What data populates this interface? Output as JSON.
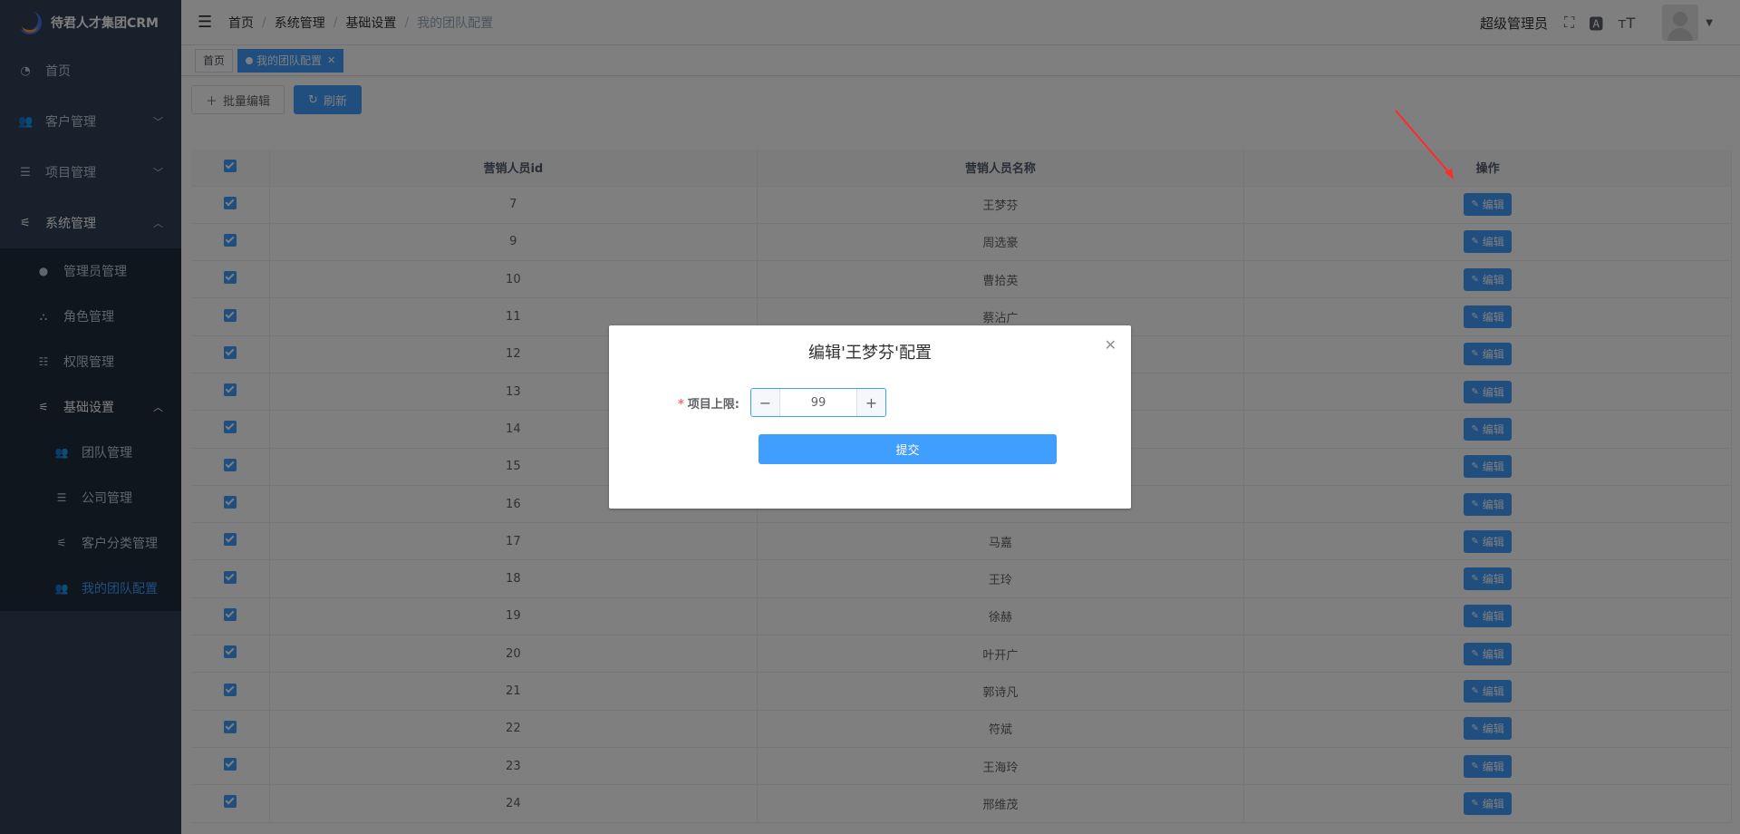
{
  "app": {
    "logo_text": "待君人才集团CRM"
  },
  "sidebar": {
    "items": [
      {
        "label": "首页",
        "icon": "dashboard-icon"
      },
      {
        "label": "客户管理",
        "icon": "users-icon"
      },
      {
        "label": "项目管理",
        "icon": "list-icon"
      },
      {
        "label": "系统管理",
        "icon": "sliders-icon"
      }
    ],
    "system_sub": [
      {
        "label": "管理员管理",
        "icon": "user-icon"
      },
      {
        "label": "角色管理",
        "icon": "tree-icon"
      },
      {
        "label": "权限管理",
        "icon": "list-check-icon"
      },
      {
        "label": "基础设置",
        "icon": "sliders-icon"
      }
    ],
    "basic_sub": [
      {
        "label": "团队管理",
        "icon": "users-icon"
      },
      {
        "label": "公司管理",
        "icon": "list-icon"
      },
      {
        "label": "客户分类管理",
        "icon": "sliders-icon"
      },
      {
        "label": "我的团队配置",
        "icon": "users-icon"
      }
    ]
  },
  "navbar": {
    "breadcrumb": [
      "首页",
      "系统管理",
      "基础设置",
      "我的团队配置"
    ],
    "user_name": "超级管理员"
  },
  "tags": {
    "home": "首页",
    "current": "我的团队配置"
  },
  "toolbar": {
    "batch_edit": "批量编辑",
    "refresh": "刷新"
  },
  "table": {
    "headers": [
      "营销人员id",
      "营销人员名称",
      "操作"
    ],
    "edit_label": "编辑",
    "rows": [
      {
        "id": "7",
        "name": "王梦芬"
      },
      {
        "id": "9",
        "name": "周选豪"
      },
      {
        "id": "10",
        "name": "曹拾英"
      },
      {
        "id": "11",
        "name": "蔡沾广"
      },
      {
        "id": "12",
        "name": ""
      },
      {
        "id": "13",
        "name": ""
      },
      {
        "id": "14",
        "name": ""
      },
      {
        "id": "15",
        "name": ""
      },
      {
        "id": "16",
        "name": ""
      },
      {
        "id": "17",
        "name": "马嘉"
      },
      {
        "id": "18",
        "name": "王玲"
      },
      {
        "id": "19",
        "name": "徐赫"
      },
      {
        "id": "20",
        "name": "叶开广"
      },
      {
        "id": "21",
        "name": "郭诗凡"
      },
      {
        "id": "22",
        "name": "符斌"
      },
      {
        "id": "23",
        "name": "王海玲"
      },
      {
        "id": "24",
        "name": "邢维茂"
      }
    ]
  },
  "dialog": {
    "title": "编辑'王梦芬'配置",
    "field_label": "项目上限:",
    "field_value": "99",
    "submit": "提交"
  },
  "colors": {
    "primary": "#409eff",
    "sidebar_bg": "#304156",
    "submenu_bg": "#1f2d3d",
    "annotation_arrow": "#ff2a2a"
  }
}
